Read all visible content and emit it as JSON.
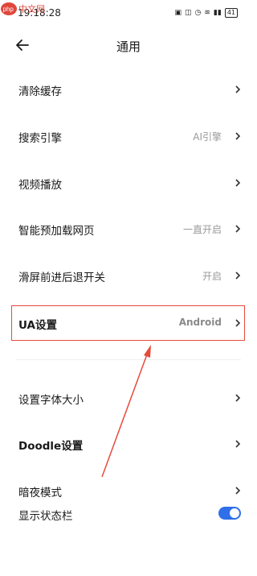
{
  "status_bar": {
    "time": "19:18:28",
    "battery": "41"
  },
  "watermark": {
    "text": "php中文网"
  },
  "header": {
    "title": "通用"
  },
  "items": [
    {
      "label": "清除缓存",
      "value": ""
    },
    {
      "label": "搜索引擎",
      "value": "AI引擎"
    },
    {
      "label": "视频播放",
      "value": ""
    },
    {
      "label": "智能预加载网页",
      "value": "一直开启"
    },
    {
      "label": "滑屏前进后退开关",
      "value": "开启"
    },
    {
      "label": "UA设置",
      "value": "Android"
    },
    {
      "label": "设置字体大小",
      "value": ""
    },
    {
      "label": "Doodle设置",
      "value": ""
    },
    {
      "label": "暗夜模式",
      "value": ""
    },
    {
      "label": "显示状态栏",
      "value": ""
    }
  ],
  "toggle": {
    "show_status_bar_on": true
  },
  "colors": {
    "accent": "#2f6fe8",
    "highlight": "#e64a3b"
  }
}
